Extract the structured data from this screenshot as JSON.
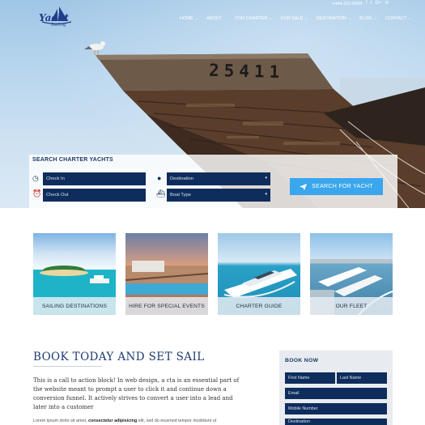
{
  "topbar": {
    "phone": "+444-222-0000",
    "socials": [
      "f",
      "t",
      "G+",
      "in"
    ]
  },
  "logo": {
    "text": "Yacht",
    "sub": "Sailing"
  },
  "nav": {
    "items": [
      {
        "label": "HOME",
        "has_caret": true
      },
      {
        "label": "ABOUT",
        "has_caret": false
      },
      {
        "label": "FOR CHARTER",
        "has_caret": true
      },
      {
        "label": "FOR SALE",
        "has_caret": true
      },
      {
        "label": "DESTINATION",
        "has_caret": true
      },
      {
        "label": "BLOG",
        "has_caret": true
      },
      {
        "label": "CONTACT",
        "has_caret": true
      }
    ]
  },
  "hero": {
    "hull_number": "25411"
  },
  "search": {
    "title": "SEARCH CHARTER YACHTS",
    "check_in": "Check In",
    "check_out": "Check Out",
    "destination": "Destination",
    "boat_type": "Boat Type",
    "button": "SEARCH FOR YACHT"
  },
  "cards": [
    {
      "label": "SAILING DESTINATIONS"
    },
    {
      "label": "HIRE FOR SPECIAL EVENTS"
    },
    {
      "label": "CHARTER GUIDE"
    },
    {
      "label": "OUR FLEET"
    }
  ],
  "cta": {
    "title": "BOOK TODAY AND SET SAIL",
    "body": "This is a call to action block! In web design, a cta is an essential part of the website meant to prompt a user to click it and continue down a conversion funnel. It actively strives to convert a user into a lead and later into a customer",
    "lorem_start": "Lorem ipsum dolor sit amet, ",
    "lorem_bold": "consectetur adipisicing",
    "lorem_end": " elit, sed do eiusmod tempor incididunt ut"
  },
  "book": {
    "title": "BOOK NOW",
    "first_name": "First Name",
    "last_name": "Last Name",
    "email": "Email",
    "mobile": "Mobile Number",
    "destination": "Destination"
  },
  "colors": {
    "navy": "#0f2d5c",
    "accent": "#3aa6ee",
    "title": "#1c3c72"
  }
}
